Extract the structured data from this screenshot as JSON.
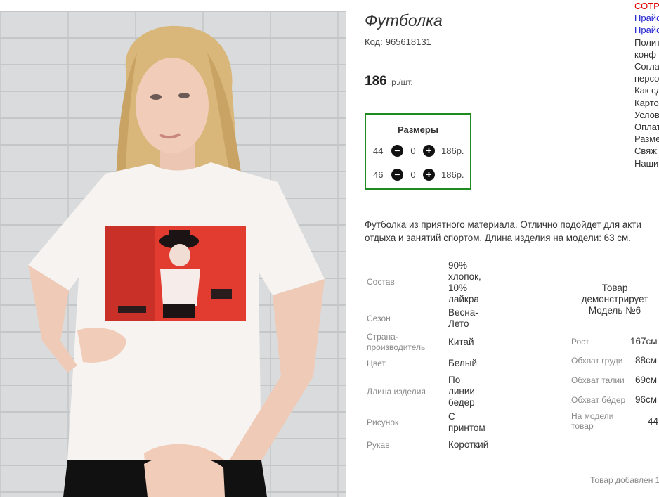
{
  "product": {
    "title": "Футболка",
    "code_label": "Код:",
    "code_value": "965618131",
    "price_value": "186",
    "price_unit": "р./шт."
  },
  "sizes": {
    "title": "Размеры",
    "rows": [
      {
        "size": "44",
        "qty": "0",
        "sum": "186р."
      },
      {
        "size": "46",
        "qty": "0",
        "sum": "186р."
      }
    ],
    "minus_icon": "minus-circle-icon",
    "plus_icon": "plus-circle-icon"
  },
  "description": [
    "Футболка из приятного материала. Отлично подойдет для акти",
    "отдыха и занятий спортом. Длина изделия на модели: 63 см."
  ],
  "specs": [
    {
      "label": [
        "Состав"
      ],
      "value": [
        "90%",
        "хлопок,",
        "10%",
        "лайкра"
      ]
    },
    {
      "label": [
        "Сезон"
      ],
      "value": [
        "Весна-",
        "Лето"
      ]
    },
    {
      "label": [
        "Страна-",
        "производитель"
      ],
      "value": [
        "Китай"
      ]
    },
    {
      "label": [
        "Цвет"
      ],
      "value": [
        "Белый"
      ]
    },
    {
      "label": [
        "Длина изделия"
      ],
      "value": [
        "По",
        "линии",
        "бедер"
      ]
    },
    {
      "label": [
        "Рисунок"
      ],
      "value": [
        "С",
        "принтом"
      ]
    },
    {
      "label": [
        "Рукав"
      ],
      "value": [
        "Короткий"
      ]
    }
  ],
  "model": {
    "heading": [
      "Товар",
      "демонстрирует",
      "Модель №6"
    ],
    "params": [
      {
        "label": [
          "Рост"
        ],
        "value": "167см"
      },
      {
        "label": [
          "Обхват груди"
        ],
        "value": "88см"
      },
      {
        "label": [
          "Обхват талии"
        ],
        "value": "69см"
      },
      {
        "label": [
          "Обхват бёдер"
        ],
        "value": "96см"
      },
      {
        "label": [
          "На модели",
          "товар"
        ],
        "value": "44"
      }
    ]
  },
  "added_text": "Товар добавлен 1",
  "side_links": [
    {
      "text": "СОТР",
      "color": "red"
    },
    {
      "text": "Прайс",
      "color": "blue"
    },
    {
      "text": "Прайс",
      "color": "blue"
    },
    {
      "text": "Полит",
      "color": "dark"
    },
    {
      "text": "конф",
      "color": "dark"
    },
    {
      "text": "Согла",
      "color": "dark"
    },
    {
      "text": "персо",
      "color": "dark"
    },
    {
      "text": "Как сд",
      "color": "dark"
    },
    {
      "text": "Карто",
      "color": "dark"
    },
    {
      "text": "Услов",
      "color": "dark"
    },
    {
      "text": "Оплат",
      "color": "dark"
    },
    {
      "text": "Разме",
      "color": "dark"
    },
    {
      "text": "Свяж",
      "color": "dark"
    },
    {
      "text": "Наши",
      "color": "dark"
    }
  ],
  "colors": {
    "accent_border": "#1f8a1f",
    "link_red": "#e00000",
    "link_blue": "#1a1acc",
    "print_red": "#e23b30"
  }
}
